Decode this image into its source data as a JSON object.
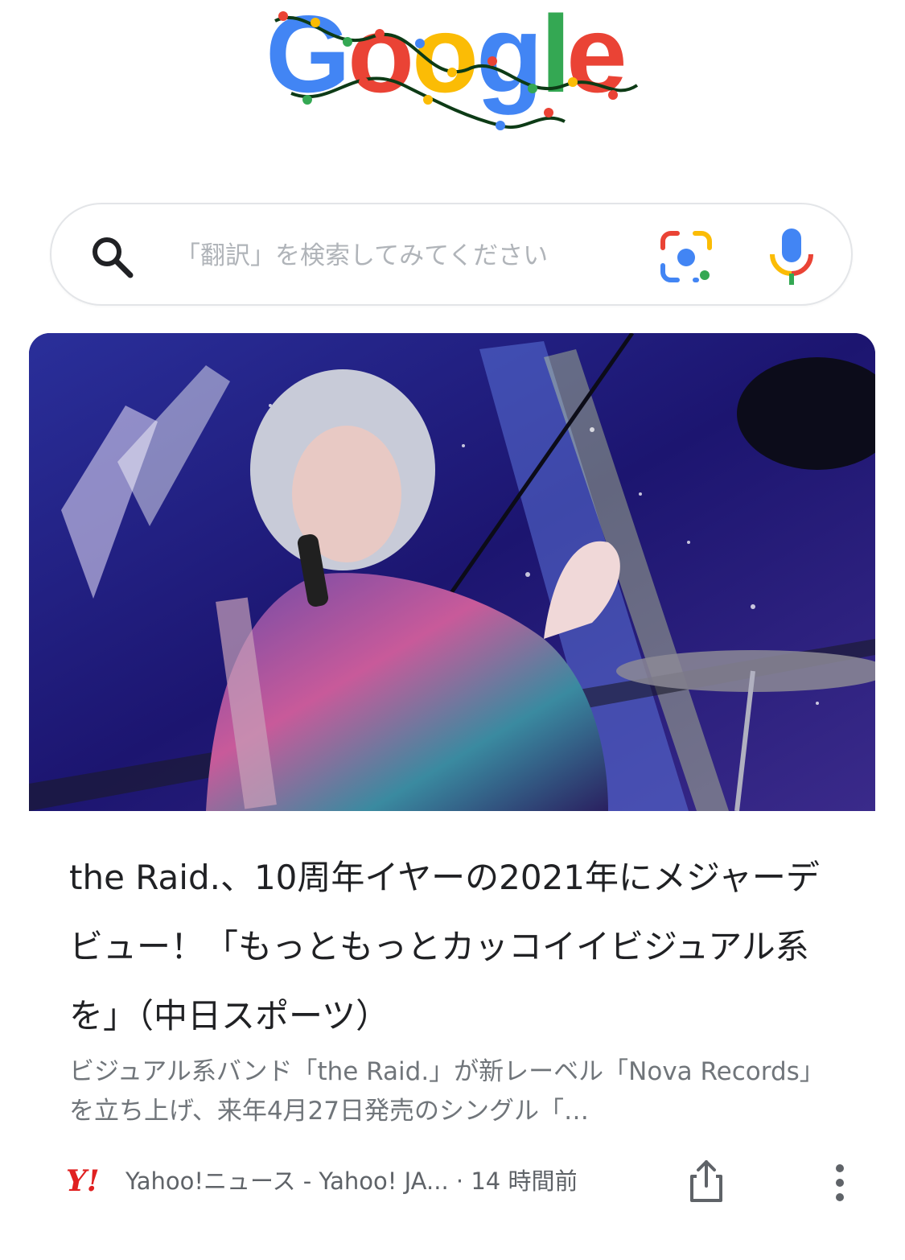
{
  "logo": {
    "text": "Google",
    "letters": [
      "G",
      "o",
      "o",
      "g",
      "l",
      "e"
    ]
  },
  "search": {
    "placeholder": "「翻訳」を検索してみてください",
    "value": ""
  },
  "card": {
    "image_alt": "the Raid. live performance photo",
    "title": "the Raid.、10周年イヤーの2021年にメジャーデビュー！「もっともっとカッコイイビジュアル系を」（中日スポーツ）",
    "snippet": "ビジュアル系バンド「the Raid.」が新レーベル「Nova Records」を立ち上げ、来年4月27日発売のシングル「…",
    "source_logo": "Y!",
    "source_text": "Yahoo!ニュース - Yahoo! JA...",
    "time": "· 14 時間前"
  },
  "colors": {
    "google_blue": "#4285f4",
    "google_red": "#ea4335",
    "google_yellow": "#fbbc05",
    "google_green": "#34a853",
    "yahoo_red": "#e02020"
  }
}
